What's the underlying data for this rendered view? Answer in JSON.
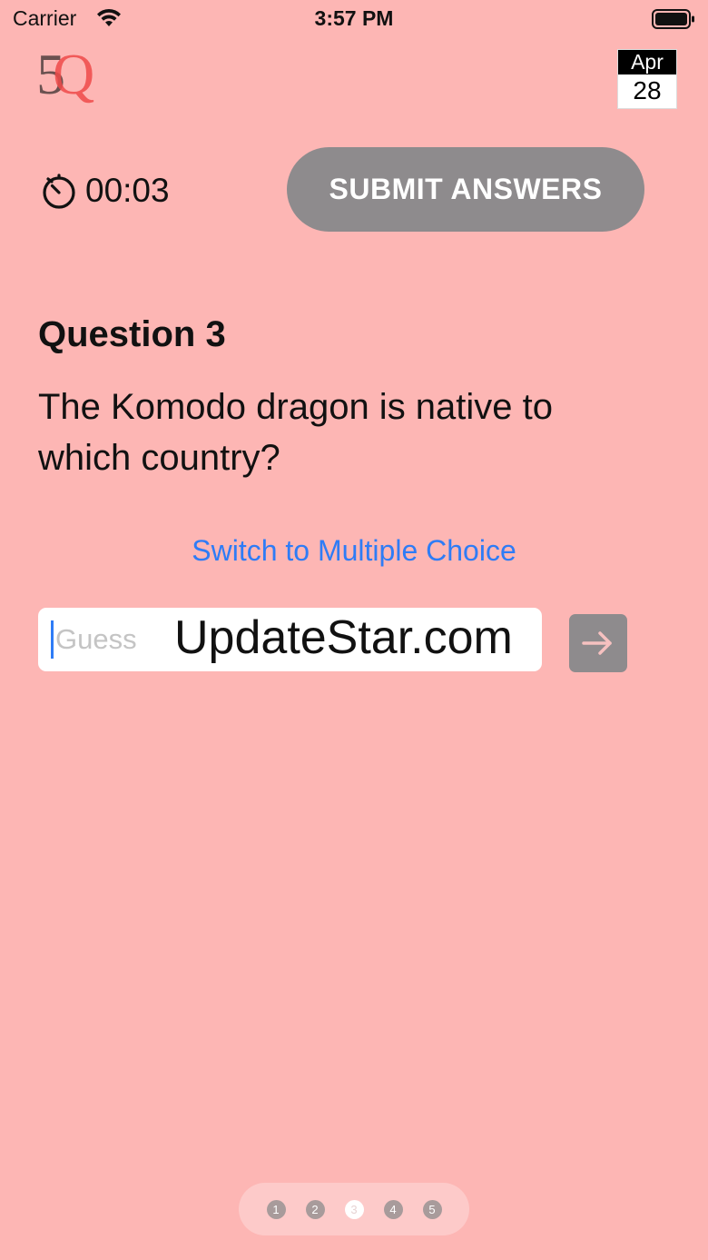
{
  "status_bar": {
    "carrier": "Carrier",
    "time": "3:57 PM",
    "wifi_icon": "wifi-icon",
    "battery_icon": "battery-icon"
  },
  "header": {
    "logo": {
      "first_char": "5",
      "second_char": "Q",
      "colors": {
        "five": "#6a5150",
        "q": "#ef4a4a"
      }
    },
    "calendar": {
      "month": "Apr",
      "day": "28"
    }
  },
  "toolbar": {
    "timer_icon": "stopwatch-icon",
    "timer": "00:03",
    "submit_label": "SUBMIT ANSWERS"
  },
  "question": {
    "title": "Question 3",
    "text": "The Komodo dragon is native to which country?"
  },
  "mode_switch": {
    "label": "Switch to Multiple Choice"
  },
  "guess": {
    "placeholder": "Guess",
    "value": "",
    "watermark": "UpdateStar.com",
    "submit_icon": "arrow-right-icon"
  },
  "pager": {
    "pages": [
      "1",
      "2",
      "3",
      "4",
      "5"
    ],
    "current": "3"
  },
  "colors": {
    "background": "#fdb6b4",
    "button_gray": "#8e8b8d",
    "link_blue": "#2e7cf6"
  }
}
